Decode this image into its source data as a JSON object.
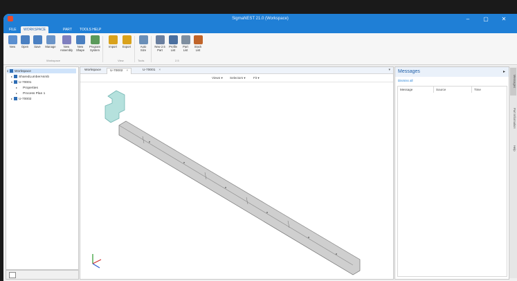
{
  "app": {
    "title": "SigmaNEST 21.0 (Workspace)"
  },
  "window_controls": {
    "minimize": "–",
    "restore": "▢",
    "close": "✕"
  },
  "menu": [
    {
      "label": "FILE"
    },
    {
      "label": "WORKSPACE",
      "active": true
    },
    {
      "label": "PART"
    },
    {
      "label": "TOOLS HELP"
    }
  ],
  "ribbon": {
    "buttons": [
      {
        "label": "New",
        "icon": "new-workspace-icon",
        "color": "#5a8fd0"
      },
      {
        "label": "Open",
        "icon": "open-workspace-icon",
        "color": "#4a80c2"
      },
      {
        "label": "Save",
        "icon": "save-workspace-icon",
        "color": "#4a80c2"
      },
      {
        "label": "Manage",
        "icon": "manage-workspace-icon",
        "color": "#6a94c8"
      },
      {
        "label": "New\nAssembly",
        "icon": "new-assembly-icon",
        "color": "#7f7fbf"
      },
      {
        "label": "New\nShape",
        "icon": "new-shape-icon",
        "color": "#4a7fc0"
      },
      {
        "label": "Program\nSystem",
        "icon": "program-system-icon",
        "color": "#5a9a5a"
      },
      {
        "label": "Import",
        "icon": "import-icon",
        "color": "#d9a21c"
      },
      {
        "label": "Export",
        "icon": "export-icon",
        "color": "#d9a21c"
      },
      {
        "label": "Auto\nSize",
        "icon": "auto-size-icon",
        "color": "#6a8fb8"
      },
      {
        "label": "New 2.5\nPart",
        "icon": "new-part-icon",
        "color": "#6a7f9f"
      },
      {
        "label": "Profile\nList",
        "icon": "profile-list-icon",
        "color": "#4a6f9f"
      },
      {
        "label": "Part\nList",
        "icon": "part-list-icon",
        "color": "#7f8fa0"
      },
      {
        "label": "Stock\nList",
        "icon": "stock-list-icon",
        "color": "#c0642a"
      }
    ],
    "groups": [
      {
        "label": "Workspace"
      },
      {
        "label": "View"
      },
      {
        "label": "Tools"
      },
      {
        "label": "2.5"
      }
    ]
  },
  "tree": {
    "items": [
      {
        "label": "Workspace",
        "level": 0,
        "selected": true,
        "icon": "workspace-icon",
        "arrow": "▾"
      },
      {
        "label": "SharedLumberAsmb",
        "level": 1,
        "icon": "assembly-icon",
        "arrow": "▸"
      },
      {
        "label": "U-70001",
        "level": 1,
        "icon": "part-icon",
        "arrow": "▾"
      },
      {
        "label": "Properties",
        "level": 2,
        "icon": "",
        "arrow": "▸"
      },
      {
        "label": "Process Plan 1",
        "level": 2,
        "icon": "",
        "arrow": "▸"
      },
      {
        "label": "U-70002",
        "level": 1,
        "icon": "part-icon",
        "arrow": "▸"
      }
    ]
  },
  "doc": {
    "tabs": [
      {
        "label": "Workspace",
        "active": false
      },
      {
        "label": "U-70002",
        "active": true
      },
      {
        "label": "U-70001",
        "active": false
      }
    ],
    "close": "×",
    "viewbar": {
      "views": "Views ▾",
      "selection": "Selectors ▾",
      "fit": "Fit ▾"
    },
    "part_color": "#cfcfcf",
    "highlight_color": "#a9dcd8"
  },
  "messages": {
    "title": "Messages",
    "dismiss_all": "Dismiss all",
    "columns": [
      "Message",
      "Source",
      "Time"
    ]
  },
  "side_tabs": [
    "Messages",
    "Part Information",
    "Help"
  ]
}
